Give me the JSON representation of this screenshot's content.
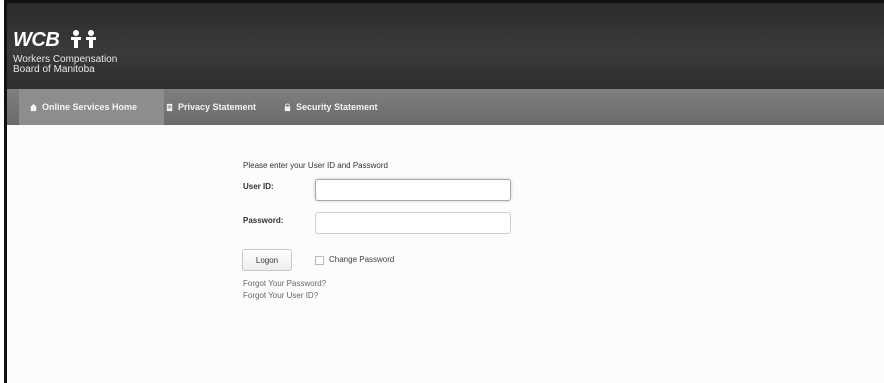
{
  "header": {
    "logo_text": "WCB",
    "logo_line1": "Workers Compensation",
    "logo_line2": "Board of Manitoba"
  },
  "nav": {
    "items": [
      {
        "label": "Online Services Home",
        "icon": "home-icon",
        "active": true
      },
      {
        "label": "Privacy Statement",
        "icon": "document-icon",
        "active": false
      },
      {
        "label": "Security Statement",
        "icon": "lock-icon",
        "active": false
      }
    ]
  },
  "login": {
    "prompt": "Please enter your User ID and Password",
    "user_id_label": "User ID:",
    "user_id_value": "",
    "password_label": "Password:",
    "password_value": "",
    "login_button": "Logon",
    "change_password_label": "Change Password",
    "change_password_checked": false,
    "forgot_password": "Forgot Your Password?",
    "forgot_user_id": "Forgot Your User ID?"
  },
  "colors": {
    "header_bg": "#333333",
    "nav_bg": "#747474",
    "nav_active": "#8d8d8d"
  }
}
